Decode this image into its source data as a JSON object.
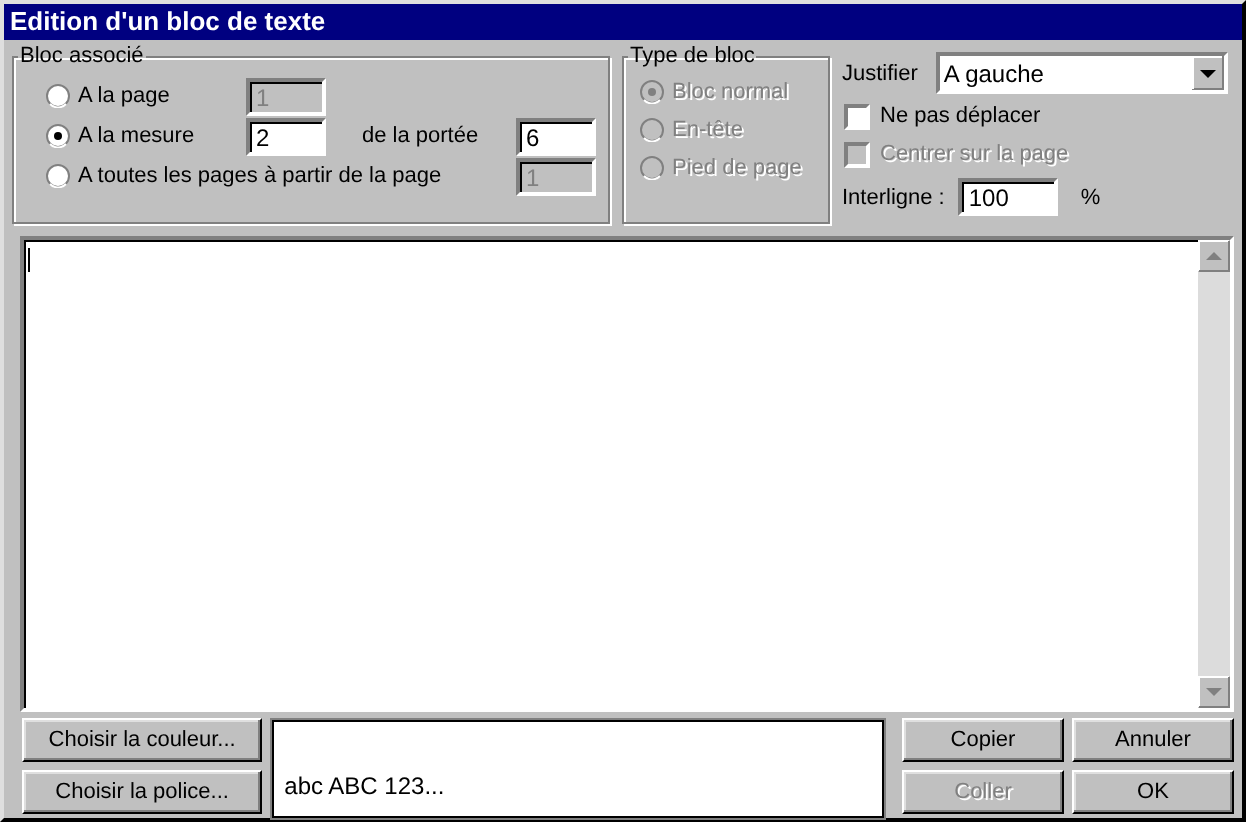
{
  "window": {
    "title": "Edition d'un bloc de texte"
  },
  "bloc_associe": {
    "title": "Bloc associé",
    "options": [
      {
        "label": "A la page",
        "selected": false,
        "field": {
          "value": "1",
          "disabled": true
        }
      },
      {
        "label": "A la mesure",
        "selected": true,
        "field": {
          "value": "2",
          "disabled": false
        },
        "extra_label": "de la portée",
        "extra_field": {
          "value": "6",
          "disabled": false
        }
      },
      {
        "label": "A toutes les pages à partir de la page",
        "selected": false,
        "field": {
          "value": "1",
          "disabled": true
        }
      }
    ]
  },
  "type_de_bloc": {
    "title": "Type de bloc",
    "disabled": true,
    "options": [
      {
        "label": "Bloc normal",
        "selected": true
      },
      {
        "label": "En-tête",
        "selected": false
      },
      {
        "label": "Pied de page",
        "selected": false
      }
    ]
  },
  "justifier": {
    "label": "Justifier",
    "value": "A gauche"
  },
  "checkboxes": [
    {
      "label": "Ne pas déplacer",
      "checked": false,
      "disabled": false
    },
    {
      "label": "Centrer sur la page",
      "checked": false,
      "disabled": true
    }
  ],
  "interligne": {
    "label": "Interligne :",
    "value": "100",
    "unit": "%"
  },
  "left_buttons": [
    {
      "label": "Choisir la couleur...",
      "disabled": false
    },
    {
      "label": "Choisir la police...",
      "disabled": false
    }
  ],
  "preview": {
    "text": "abc ABC 123..."
  },
  "right_buttons": [
    {
      "label": "Copier",
      "disabled": false
    },
    {
      "label": "Annuler",
      "disabled": false
    },
    {
      "label": "Coller",
      "disabled": true
    },
    {
      "label": "OK",
      "disabled": false
    }
  ]
}
